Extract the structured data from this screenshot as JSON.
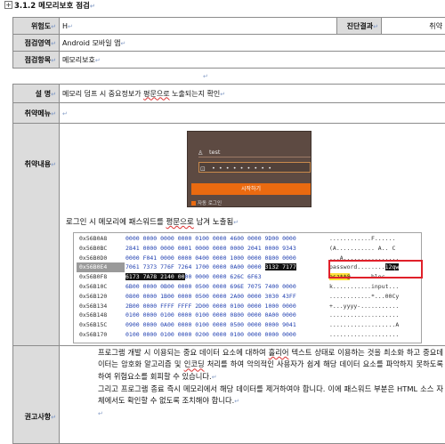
{
  "heading": {
    "anchor": "+",
    "title": "3.1.2 메모리보호 점검"
  },
  "summary": {
    "risk_label": "위험도",
    "risk_value": "H",
    "diag_label": "진단결과",
    "diag_value": "취약",
    "area_label": "점검영역",
    "area_value": "Android 모바일 앱",
    "item_label": "점검항목",
    "item_value": "메모리보호"
  },
  "detail": {
    "desc_label": "설 명",
    "desc_value_pre": "메모리 덤프 시 중요정보가 ",
    "desc_value_mark": "평문으로",
    "desc_value_post": " 노출되는지 확인",
    "menu_label": "취약메뉴",
    "content_label": "취약내용",
    "rec_label": "권고사항"
  },
  "login_shot": {
    "username": "test",
    "password_mask": "• • • • • • • • •",
    "login_button": "시작하기",
    "remember_label": "자동 로그인"
  },
  "caption": {
    "pre": "로그인 시 메모리에 패스워드를 ",
    "mark": "평문으로",
    "post": " 남겨 노출됨"
  },
  "hex_dump": [
    {
      "addr": "0x56B0A8",
      "bytes": "0000 0000 0000 0000 0100 0000 4600 0000 9D00 0000",
      "ascii": "............F......"
    },
    {
      "addr": "0x56B0BC",
      "bytes": "2841 0000 0000 0001 0000 0000 0000 2041 0000 9343",
      "ascii": "(A........... A.. C"
    },
    {
      "addr": "0x56B0D0",
      "bytes": "0000 F041 0000 0000 0400 0000 1000 0000 0800 0000",
      "ascii": "...A................"
    },
    {
      "addr": "0x56B0E4",
      "bytes_pre": "7061 7373 776F 7264 1700 0000 0A00 0000 ",
      "bytes_mark": "3132 7177",
      "ascii_pre": "password........",
      "ascii_mark": "12qw"
    },
    {
      "addr": "0x56B0F8",
      "bytes_mark": "6173 7A78 2140 00",
      "bytes_post": "00 0000 0000 626C 6F63",
      "ascii_mark": "asz**@",
      "ascii_post": "......bloc"
    },
    {
      "addr": "0x56B10C",
      "bytes": "6B00 0000 0B00 0000 0500 0000 696E 7075 7400 0000",
      "ascii": "k...........input..."
    },
    {
      "addr": "0x56B120",
      "bytes": "0800 0000 1B00 0000 0500 0000 2A00 0000 3030 43FF",
      "ascii": "............*...00Cy"
    },
    {
      "addr": "0x56B134",
      "bytes": "2B00 0000 FFFF FFFF 2D00 0000 0100 0000 1000 0000",
      "ascii": "+...yyyy-..........."
    },
    {
      "addr": "0x56B148",
      "bytes": "0100 0000 0100 0000 0100 0000 0800 0000 0A00 0000",
      "ascii": "...................."
    },
    {
      "addr": "0x56B15C",
      "bytes": "0900 0000 0A00 0000 0100 0000 0500 0000 0000 9041",
      "ascii": "...................A"
    },
    {
      "addr": "0x56B170",
      "bytes": "0100 0000 0100 0000 0200 0000 0100 0000 0000 0000",
      "ascii": "...................."
    }
  ],
  "recommendation": [
    "프로그램 개발 시 이용되는 중요 데이터 요소에 대하여 ",
    "흘리어",
    " 텍스트 상태로 이용하는 것을 최소화 하고 중요데이터는 암호화 알고리즘 및 ",
    "인코딩",
    " 처리를 하여 악의적인 사용자가 쉽게 해당 데이터 요소를 파악하지 못하도록 하여 위험요소를 회피할 수 있습니다.",
    "그리고 프로그램 종료 즉시 메모리에서 해당 데이터를 제거하여야 합니다. 이에 패스워드 부분은 HTML 소스 자체에서도 확인할 수 없도록 조치해야 합니다."
  ],
  "para_mark": "↵"
}
